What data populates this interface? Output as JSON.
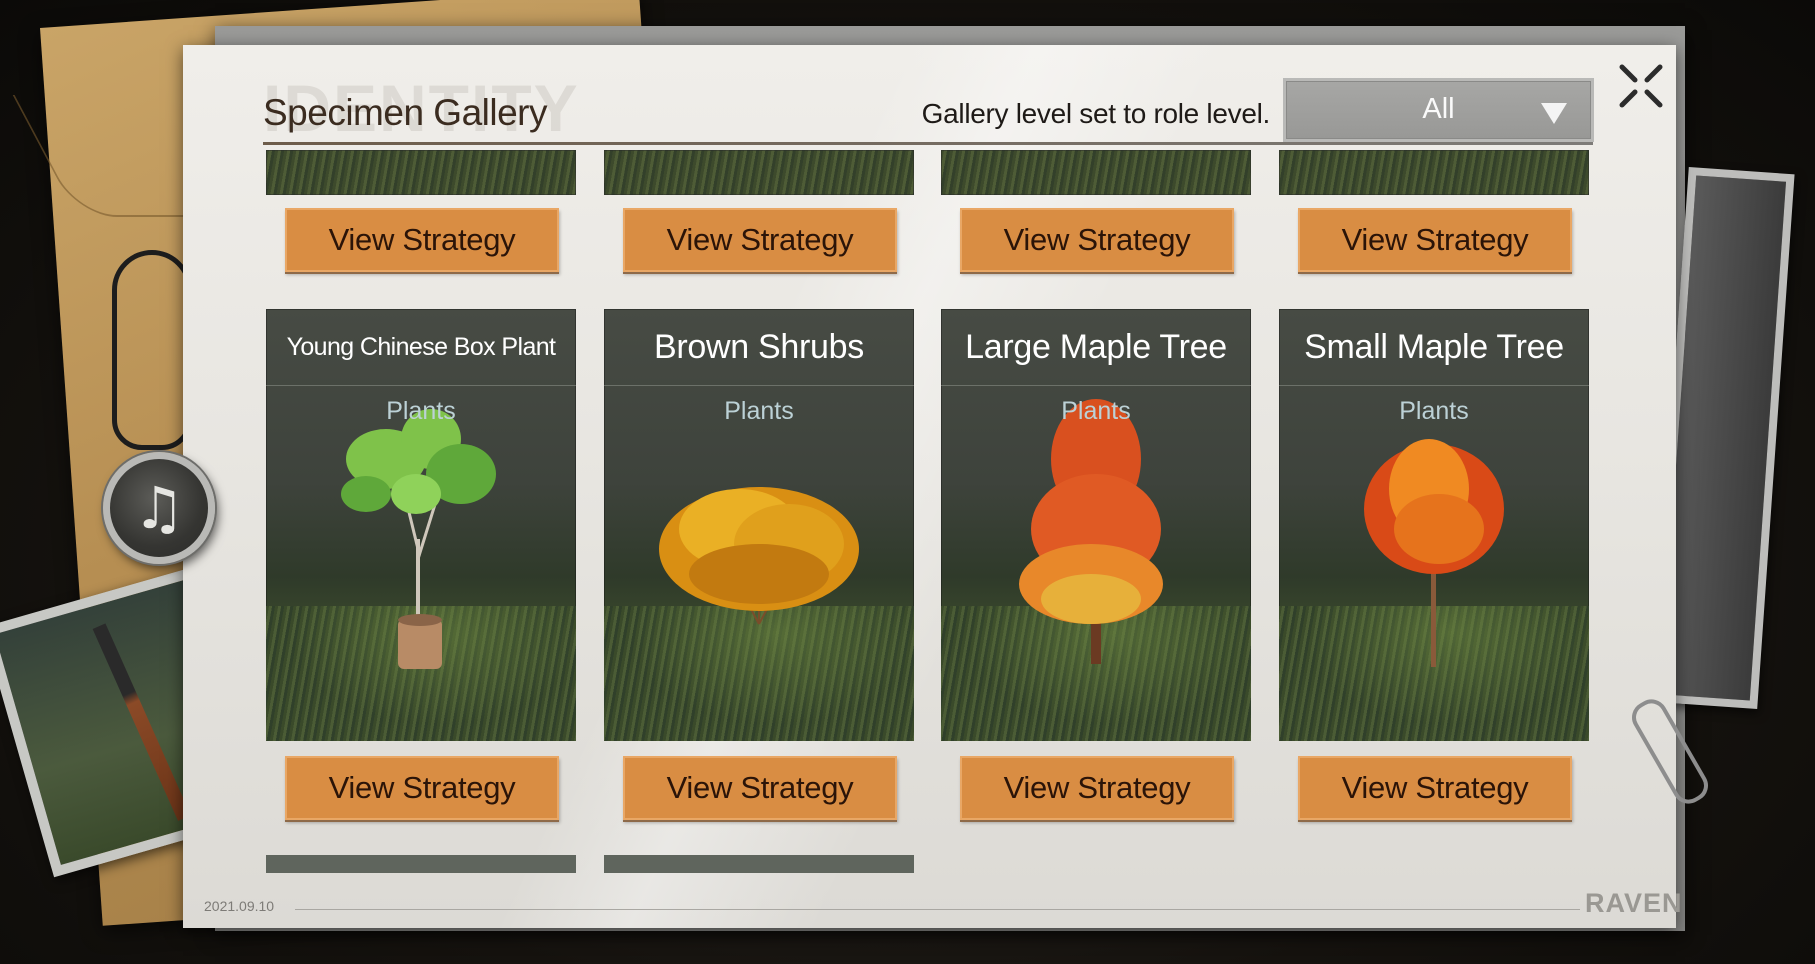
{
  "header": {
    "watermark": "IDENTITY",
    "title": "Specimen Gallery",
    "level_note": "Gallery level set to role level.",
    "filter": {
      "selected": "All"
    }
  },
  "icons": {
    "close": "close-icon",
    "dropdown": "chevron-down-icon",
    "music": "music-note-icon",
    "music_glyph": "♫"
  },
  "top_row_buttons": [
    {
      "label": "View Strategy"
    },
    {
      "label": "View Strategy"
    },
    {
      "label": "View Strategy"
    },
    {
      "label": "View Strategy"
    }
  ],
  "cards": [
    {
      "name": "Young Chinese Box Plant",
      "category": "Plants",
      "button": "View Strategy",
      "foliage": "#7fc24a"
    },
    {
      "name": "Brown Shrubs",
      "category": "Plants",
      "button": "View Strategy",
      "foliage": "#e3a11d"
    },
    {
      "name": "Large Maple Tree",
      "category": "Plants",
      "button": "View Strategy",
      "foliage": "#d9501f"
    },
    {
      "name": "Small Maple Tree",
      "category": "Plants",
      "button": "View Strategy",
      "foliage": "#e8671a"
    }
  ],
  "footer": {
    "date": "2021.09.10",
    "brand": "RAVEN"
  },
  "colors": {
    "button_bg": "#d98d43",
    "button_text": "#2b1408",
    "title_text": "#3b2c20",
    "card_bg": "#474b44"
  }
}
